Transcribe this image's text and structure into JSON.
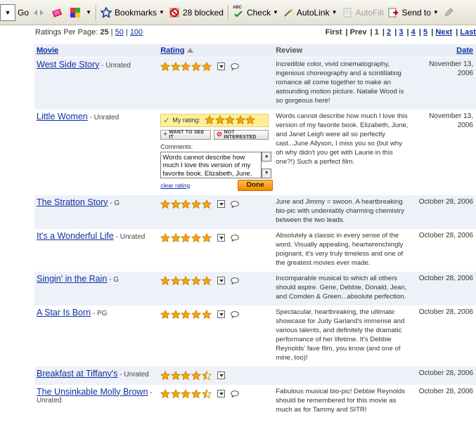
{
  "toolbar": {
    "go_label": "Go",
    "bookmarks_label": "Bookmarks",
    "blocked_label": "28 blocked",
    "check_label": "Check",
    "check_badge": "ABC",
    "autolink_label": "AutoLink",
    "autofill_label": "AutoFill",
    "sendto_label": "Send to"
  },
  "ratings_per_page": {
    "label": "Ratings Per Page:",
    "current": "25",
    "sep": "|",
    "options": [
      "50",
      "100"
    ]
  },
  "pagination": {
    "first": "First",
    "prev": "Prev",
    "current": "1",
    "pages": [
      "2",
      "3",
      "4",
      "5"
    ],
    "next": "Next",
    "last": "Last"
  },
  "columns": {
    "movie": "Movie",
    "rating": "Rating",
    "review": "Review",
    "date": "Date"
  },
  "editor": {
    "my_rating_label": "My rating:",
    "want_label": "WANT TO SEE IT",
    "not_interested_label": "NOT INTERESTED",
    "comments_label": "Comments:",
    "comment_text": "Words cannot describe how much I love this version of my favorite book. Elizabeth, June, and Janet Leigh were all so perfectly cast...June Allyson, I miss you so",
    "clear_label": "clear rating",
    "done_label": "Done"
  },
  "colors": {
    "link": "#1030a0",
    "star": "#f6a800",
    "row_alt": "#eef1f8",
    "done_button": "#f6a000"
  },
  "rows": [
    {
      "title": "West Side Story",
      "mpaa": "- Unrated",
      "stars": 5,
      "review": "Incredible color, vivid cinematography, ingenious choreography and a scintillating romance all come together to make an astounding motion picture. Natalie Wood is so gorgeous here!",
      "date": "November 13, 2006"
    },
    {
      "title": "Little Women",
      "mpaa": "- Unrated",
      "stars": 5,
      "review": "Words cannot describe how much I love this version of my favorite book. Elizabeth, June, and Janet Leigh were all so perfectly cast...June Allyson, I miss you so (but why oh why didn't you get with Laurie in this one?!) Such a perfect film.",
      "date": "November 13, 2006"
    },
    {
      "title": "The Stratton Story",
      "mpaa": "- G",
      "stars": 5,
      "review": "June and Jimmy = swoon. A heartbreaking bio-pic with undeniably charming chemistry between the two leads.",
      "date": "October 28, 2006"
    },
    {
      "title": "It's a Wonderful Life",
      "mpaa": "- Unrated",
      "stars": 5,
      "review": "Absolutely a classic in every sense of the word. Visually appealing, heartwrenchingly poignant, it's very truly timeless and one of the greatest movies ever made.",
      "date": "October 28, 2006"
    },
    {
      "title": "Singin' in the Rain",
      "mpaa": "- G",
      "stars": 5,
      "review": "Incomparable musical to which all others should aspire. Gene, Debbie, Donald, Jean, and Comden & Green...absolute perfection.",
      "date": "October 28, 2006"
    },
    {
      "title": "A Star Is Born",
      "mpaa": "- PG",
      "stars": 5,
      "review": "Spectacular, heartbreaking, the ultimate showcase for Judy Garland's immense and various talents, and definitely the dramatic performance of her lifetime. It's Debbie Reynolds' fave film, you know (and one of mine, too)!",
      "date": "October 28, 2006"
    },
    {
      "title": "Breakfast at Tiffany's",
      "mpaa": "- Unrated",
      "stars": 4.5,
      "review": "",
      "date": "October 28, 2006"
    },
    {
      "title": "The Unsinkable Molly Brown",
      "mpaa": "- Unrated",
      "stars": 4.5,
      "review": "Fabulous musical bio-pic! Debbie Reynolds should be remembered for this movie as much as for Tammy and SITR!",
      "date": "October 28, 2006"
    }
  ]
}
